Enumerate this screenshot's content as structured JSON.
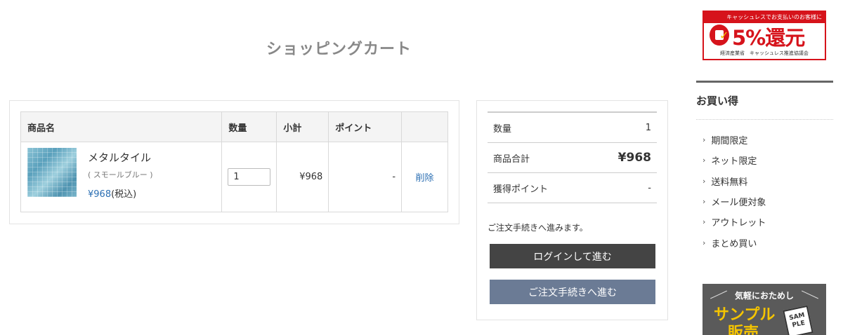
{
  "page": {
    "title": "ショッピングカート"
  },
  "cart": {
    "headers": {
      "product": "商品名",
      "quantity": "数量",
      "subtotal": "小計",
      "point": "ポイント",
      "action": ""
    },
    "items": [
      {
        "name": "メタルタイル",
        "variant": "( スモールブルー )",
        "price": "¥968",
        "tax_label": "(税込)",
        "quantity": "1",
        "subtotal": "¥968",
        "point": "-",
        "delete_label": "削除"
      }
    ]
  },
  "summary": {
    "rows": [
      {
        "label": "数量",
        "value": "1"
      },
      {
        "label": "商品合計",
        "value": "¥968"
      },
      {
        "label": "獲得ポイント",
        "value": "-"
      }
    ],
    "note": "ご注文手続きへ進みます。",
    "login_button": "ログインして進む",
    "order_button": "ご注文手続きへ進む"
  },
  "sidebar": {
    "cashless_banner": {
      "top_text": "キャッシュレスでお支払いのお客様に",
      "main_text": "5%還元",
      "bottom_text": "経済産業省　キャッシュレス推進協議会"
    },
    "section_title": "お買い得",
    "items": [
      {
        "label": "期間限定"
      },
      {
        "label": "ネット限定"
      },
      {
        "label": "送料無料"
      },
      {
        "label": "メール便対象"
      },
      {
        "label": "アウトレット"
      },
      {
        "label": "まとめ買い"
      }
    ],
    "sample_banner": {
      "top_text": "気軽におためし",
      "main_line1": "サンプル",
      "main_line2": "販売",
      "card_text": "SAM PLE"
    }
  },
  "colors": {
    "accent_link": "#2c6fb3",
    "login_button": "#444444",
    "order_button": "#6b7b95",
    "banner_red": "#d6131b"
  }
}
